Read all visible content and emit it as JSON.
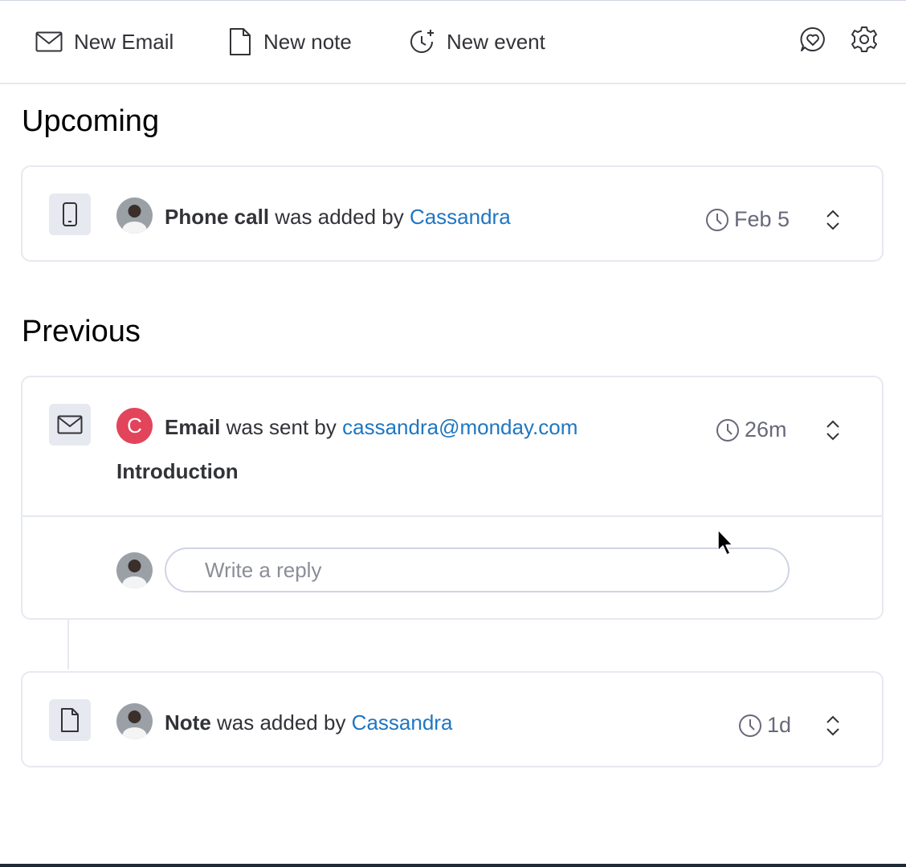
{
  "toolbar": {
    "new_email": "New Email",
    "new_note": "New note",
    "new_event": "New event",
    "icons": {
      "email": "envelope-icon",
      "note": "document-icon",
      "event": "clock-plus-icon",
      "feedback": "heart-chat-icon",
      "settings": "gear-icon"
    }
  },
  "sections": {
    "upcoming": "Upcoming",
    "previous": "Previous"
  },
  "upcoming_item": {
    "type": "Phone call",
    "action": " was added by ",
    "user": "Cassandra",
    "time": "Feb 5"
  },
  "email_item": {
    "type": "Email",
    "action": " was sent by ",
    "user": "cassandra@monday.com",
    "time": "26m",
    "subject": "Introduction",
    "avatar_letter": "C",
    "reply_placeholder": "Write a reply"
  },
  "note_item": {
    "type": "Note",
    "action": " was added by ",
    "user": "Cassandra",
    "time": "1d"
  },
  "colors": {
    "link": "#1f76c2",
    "avatar_red": "#e2445c",
    "icon_bg": "#e6e9ef",
    "border": "#e6e9ef"
  }
}
